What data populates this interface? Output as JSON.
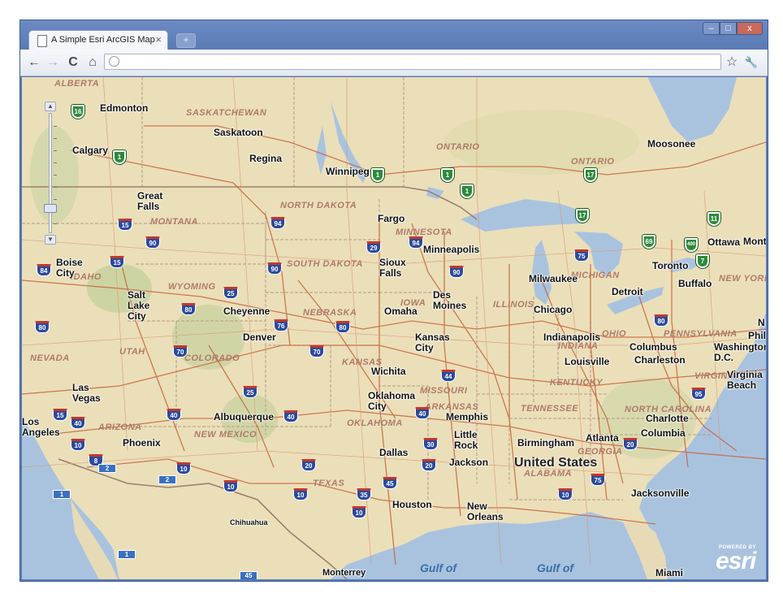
{
  "window": {
    "tab_title": "A Simple Esri ArcGIS Map",
    "tab_close": "×",
    "new_tab": "+",
    "minimize": "–",
    "maximize": "□",
    "close": "x"
  },
  "toolbar": {
    "back": "←",
    "forward": "→",
    "reload": "C",
    "home": "⌂",
    "url_value": "",
    "star": "☆",
    "wrench": "🔧"
  },
  "map": {
    "zoom_level": 0.82,
    "cities": [
      "Edmonton",
      "Saskatoon",
      "Calgary",
      "Regina",
      "Winnipeg",
      "Moosonee",
      "Great Falls",
      "Fargo",
      "Minneapolis",
      "Ottawa",
      "Mont",
      "Boise City",
      "Sioux Falls",
      "Toronto",
      "Buffalo",
      "Milwaukee",
      "Detroit",
      "Salt Lake City",
      "Des Moines",
      "Cheyenne",
      "Omaha",
      "Chicago",
      "Denver",
      "Kansas City",
      "Indianapolis",
      "Columbus",
      "Washington D.C.",
      "Philad",
      "Louisville",
      "Charleston",
      "Wichita",
      "Virginia Beach",
      "Las Vegas",
      "Oklahoma City",
      "Memphis",
      "Los Angeles",
      "Albuquerque",
      "Charlotte",
      "Little Rock",
      "Birmingham",
      "Atlanta",
      "Columbia",
      "Phoenix",
      "Dallas",
      "Jackson",
      "Houston",
      "New Orleans",
      "Jacksonville",
      "Chihuahua",
      "Monterrey",
      "Miami",
      "N"
    ],
    "regions": [
      "ALBERTA",
      "SASKATCHEWAN",
      "ONTARIO",
      "ONTARIO",
      "NORTH DAKOTA",
      "MONTANA",
      "MINNESOTA",
      "SOUTH DAKOTA",
      "IDAHO",
      "WYOMING",
      "IOWA",
      "MICHIGAN",
      "NEW YORK",
      "NEBRASKA",
      "ILLINOIS",
      "OHIO",
      "PENNSYLVANIA",
      "INDIANA",
      "NEVADA",
      "UTAH",
      "COLORADO",
      "KANSAS",
      "MISSOURI",
      "KENTUCKY",
      "VIRGINIA",
      "ARIZONA",
      "NEW MEXICO",
      "OKLAHOMA",
      "ARKANSAS",
      "TENNESSEE",
      "NORTH CAROLINA",
      "GEORGIA",
      "ALABAMA",
      "TEXAS"
    ],
    "country": "United States",
    "gulf_1": "Gulf of",
    "gulf_2": "Gulf of",
    "us_shields": [
      "15",
      "90",
      "94",
      "29",
      "94",
      "90",
      "75",
      "15",
      "84",
      "90",
      "25",
      "80",
      "76",
      "80",
      "80",
      "70",
      "70",
      "44",
      "25",
      "40",
      "40",
      "15",
      "10",
      "40",
      "40",
      "30",
      "20",
      "20",
      "10",
      "10",
      "45",
      "35",
      "10",
      "10",
      "75",
      "10",
      "20",
      "95",
      "80",
      "8"
    ],
    "ca_shields": [
      "16",
      "1",
      "1",
      "1",
      "1",
      "17",
      "17",
      "11",
      "69",
      "400",
      "7"
    ],
    "mx_shields": [
      "2",
      "2",
      "1",
      "1",
      "45"
    ],
    "esri_powered": "POWERED BY",
    "esri_word": "esri"
  }
}
